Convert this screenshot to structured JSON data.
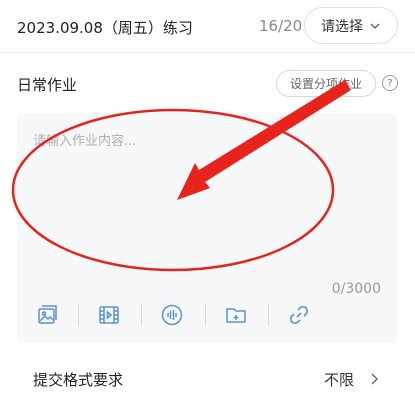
{
  "header": {
    "title": "2023.09.08（周五）练习",
    "counter": "16/20",
    "select_label": "请选择"
  },
  "homework": {
    "section_label": "日常作业",
    "split_button_label": "设置分项作业",
    "help_icon": "?"
  },
  "editor": {
    "placeholder": "请输入作业内容...",
    "char_count": "0/3000"
  },
  "toolbar": {
    "icons": [
      "image-icon",
      "video-icon",
      "audio-icon",
      "folder-icon",
      "link-icon"
    ]
  },
  "format": {
    "label": "提交格式要求",
    "value": "不限"
  },
  "colors": {
    "accent": "#5b8fd6",
    "annotation": "#e8231b"
  }
}
